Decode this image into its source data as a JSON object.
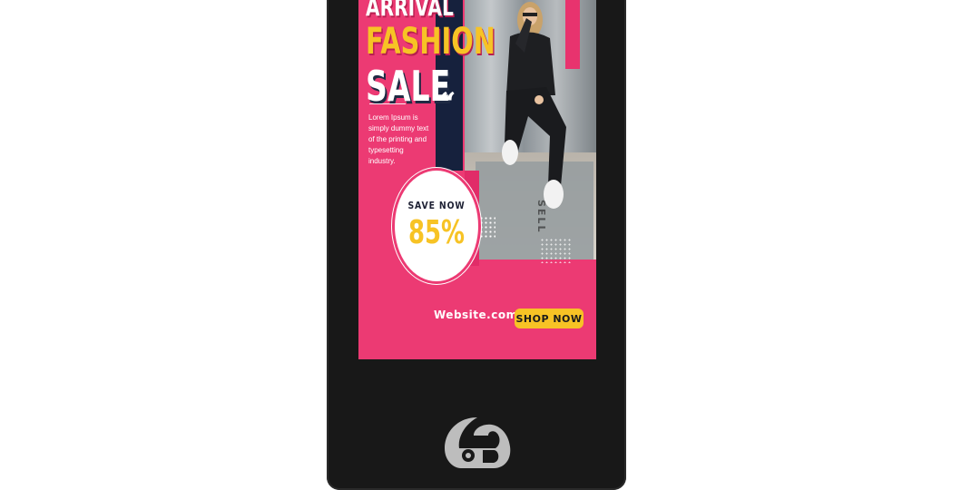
{
  "ad": {
    "title_line1": "ARRIVAL",
    "title_line2": "FASHION",
    "title_line3": "SALE",
    "quote_mark": "“",
    "description": "Lorem Ipsum is simply dummy text of the printing and typesetting industry.",
    "save_label": "SAVE NOW",
    "discount": "85%",
    "website": "Website.com",
    "cta_label": "SHOP NOW",
    "side_text": "SELL"
  },
  "colors": {
    "background_pink": "#ec3a73",
    "accent_yellow": "#f7c325",
    "navy": "#16213d",
    "kiosk_body": "#181818",
    "logo_gray": "#bdbdbd"
  },
  "icons": {
    "kiosk_logo": "brand-logo-icon"
  }
}
